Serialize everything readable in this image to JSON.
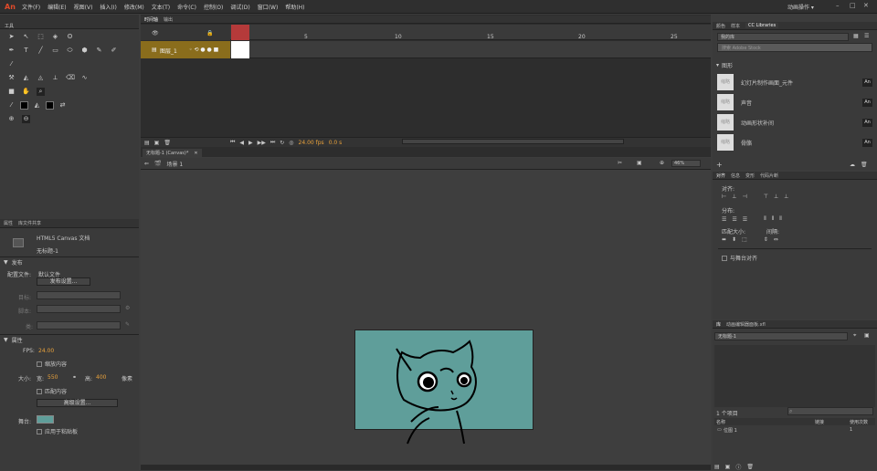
{
  "app": {
    "logo": "An",
    "menus": [
      "文件(F)",
      "编辑(E)",
      "视图(V)",
      "插入(I)",
      "修改(M)",
      "文本(T)",
      "命令(C)",
      "控制(O)",
      "调试(D)",
      "窗口(W)",
      "帮助(H)"
    ],
    "workspace": "动画操作 ▾"
  },
  "timeline": {
    "tabs": [
      "时间轴",
      "输出"
    ],
    "layer_name": "图层_1",
    "ruler": [
      "1",
      "5",
      "10",
      "15",
      "20",
      "25"
    ],
    "fps": "24.00 fps",
    "time": "0.0 s",
    "frame": "1"
  },
  "tools": {
    "title": "工具"
  },
  "doc": {
    "tab": "无标题-1 (Canvas)*",
    "scene": "场景 1",
    "zoom": "46%"
  },
  "properties": {
    "tabs": [
      "属性",
      "库文件共享"
    ],
    "doc_type": "HTML5 Canvas 文档",
    "doc_name": "无标题-1",
    "publish_section": "发布",
    "profile_label": "配置文件:",
    "profile_value": "默认文件",
    "publish_settings_btn": "发布设置...",
    "target_label": "目标:",
    "script_label": "脚本:",
    "class_label": "类:",
    "props_section": "属性",
    "fps_label": "FPS:",
    "fps_value": "24.00",
    "scale_content": "缩放内容",
    "size_label": "大小:",
    "width_label": "宽:",
    "width_value": "550",
    "height_label": "高:",
    "height_value": "400",
    "unit": "像素",
    "match_contents": "匹配内容",
    "advanced_btn": "高级设置...",
    "stage_label": "舞台:",
    "apply_pasteboard": "应用于粘贴板"
  },
  "libraries": {
    "tabs": [
      "颜色",
      "样本",
      "CC Libraries"
    ],
    "selector": "我的库",
    "search_placeholder": "搜索 Adobe Stock",
    "group": "图形",
    "items": [
      {
        "name": "幻灯片制作画面_元件",
        "badge": "An",
        "thumb": "缩略"
      },
      {
        "name": "声音",
        "badge": "An",
        "thumb": "缩略"
      },
      {
        "name": "动画形状补间",
        "badge": "An",
        "thumb": "缩略"
      },
      {
        "name": "骨骼",
        "badge": "An",
        "thumb": "缩略"
      }
    ]
  },
  "align": {
    "tabs": [
      "对齐",
      "信息",
      "变形",
      "代码片断"
    ],
    "align_label": "对齐:",
    "distribute_label": "分布:",
    "match_size_label": "匹配大小:",
    "spacing_label": "间隔:",
    "to_stage": "与舞台对齐"
  },
  "library": {
    "tabs": [
      "库",
      "动画编辑器面板.xfl"
    ],
    "doc_select": "无标题-1",
    "count": "1 个项目",
    "col_name": "名称",
    "col_link": "链接",
    "col_use": "使用次数",
    "item_name": "位图 1",
    "item_uses": "1"
  },
  "colors": {
    "accent": "#e8a13b",
    "layer_bar": "#8a6d1c",
    "stage": "#5f9e9a",
    "playhead": "#b53a3a"
  }
}
